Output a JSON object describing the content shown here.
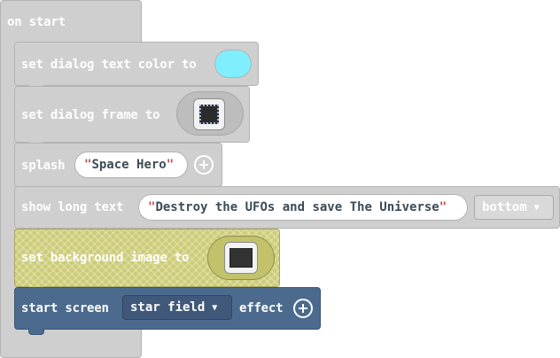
{
  "blocks": {
    "on_start": {
      "label": "on start"
    },
    "dialog_color": {
      "label": "set dialog text color to",
      "color": "#7fefff"
    },
    "dialog_frame": {
      "label": "set dialog frame to"
    },
    "splash": {
      "label": "splash",
      "text": "Space Hero"
    },
    "long_text": {
      "label": "show long text",
      "text": "Destroy the UFOs and save The Universe",
      "position": "bottom"
    },
    "background": {
      "label": "set background image to"
    },
    "effect": {
      "prefix": "start screen",
      "value": "star field",
      "suffix": "effect"
    }
  },
  "colors": {
    "gray_block": "#cfcfcf",
    "yellow_block": "#cccc77",
    "blue_block": "#4b6a8e"
  },
  "icons": {
    "frame": "dialog-frame-thumbnail-icon",
    "background": "background-image-thumbnail-icon",
    "dropdown": "caret-down-icon",
    "add": "plus-circle-icon"
  }
}
